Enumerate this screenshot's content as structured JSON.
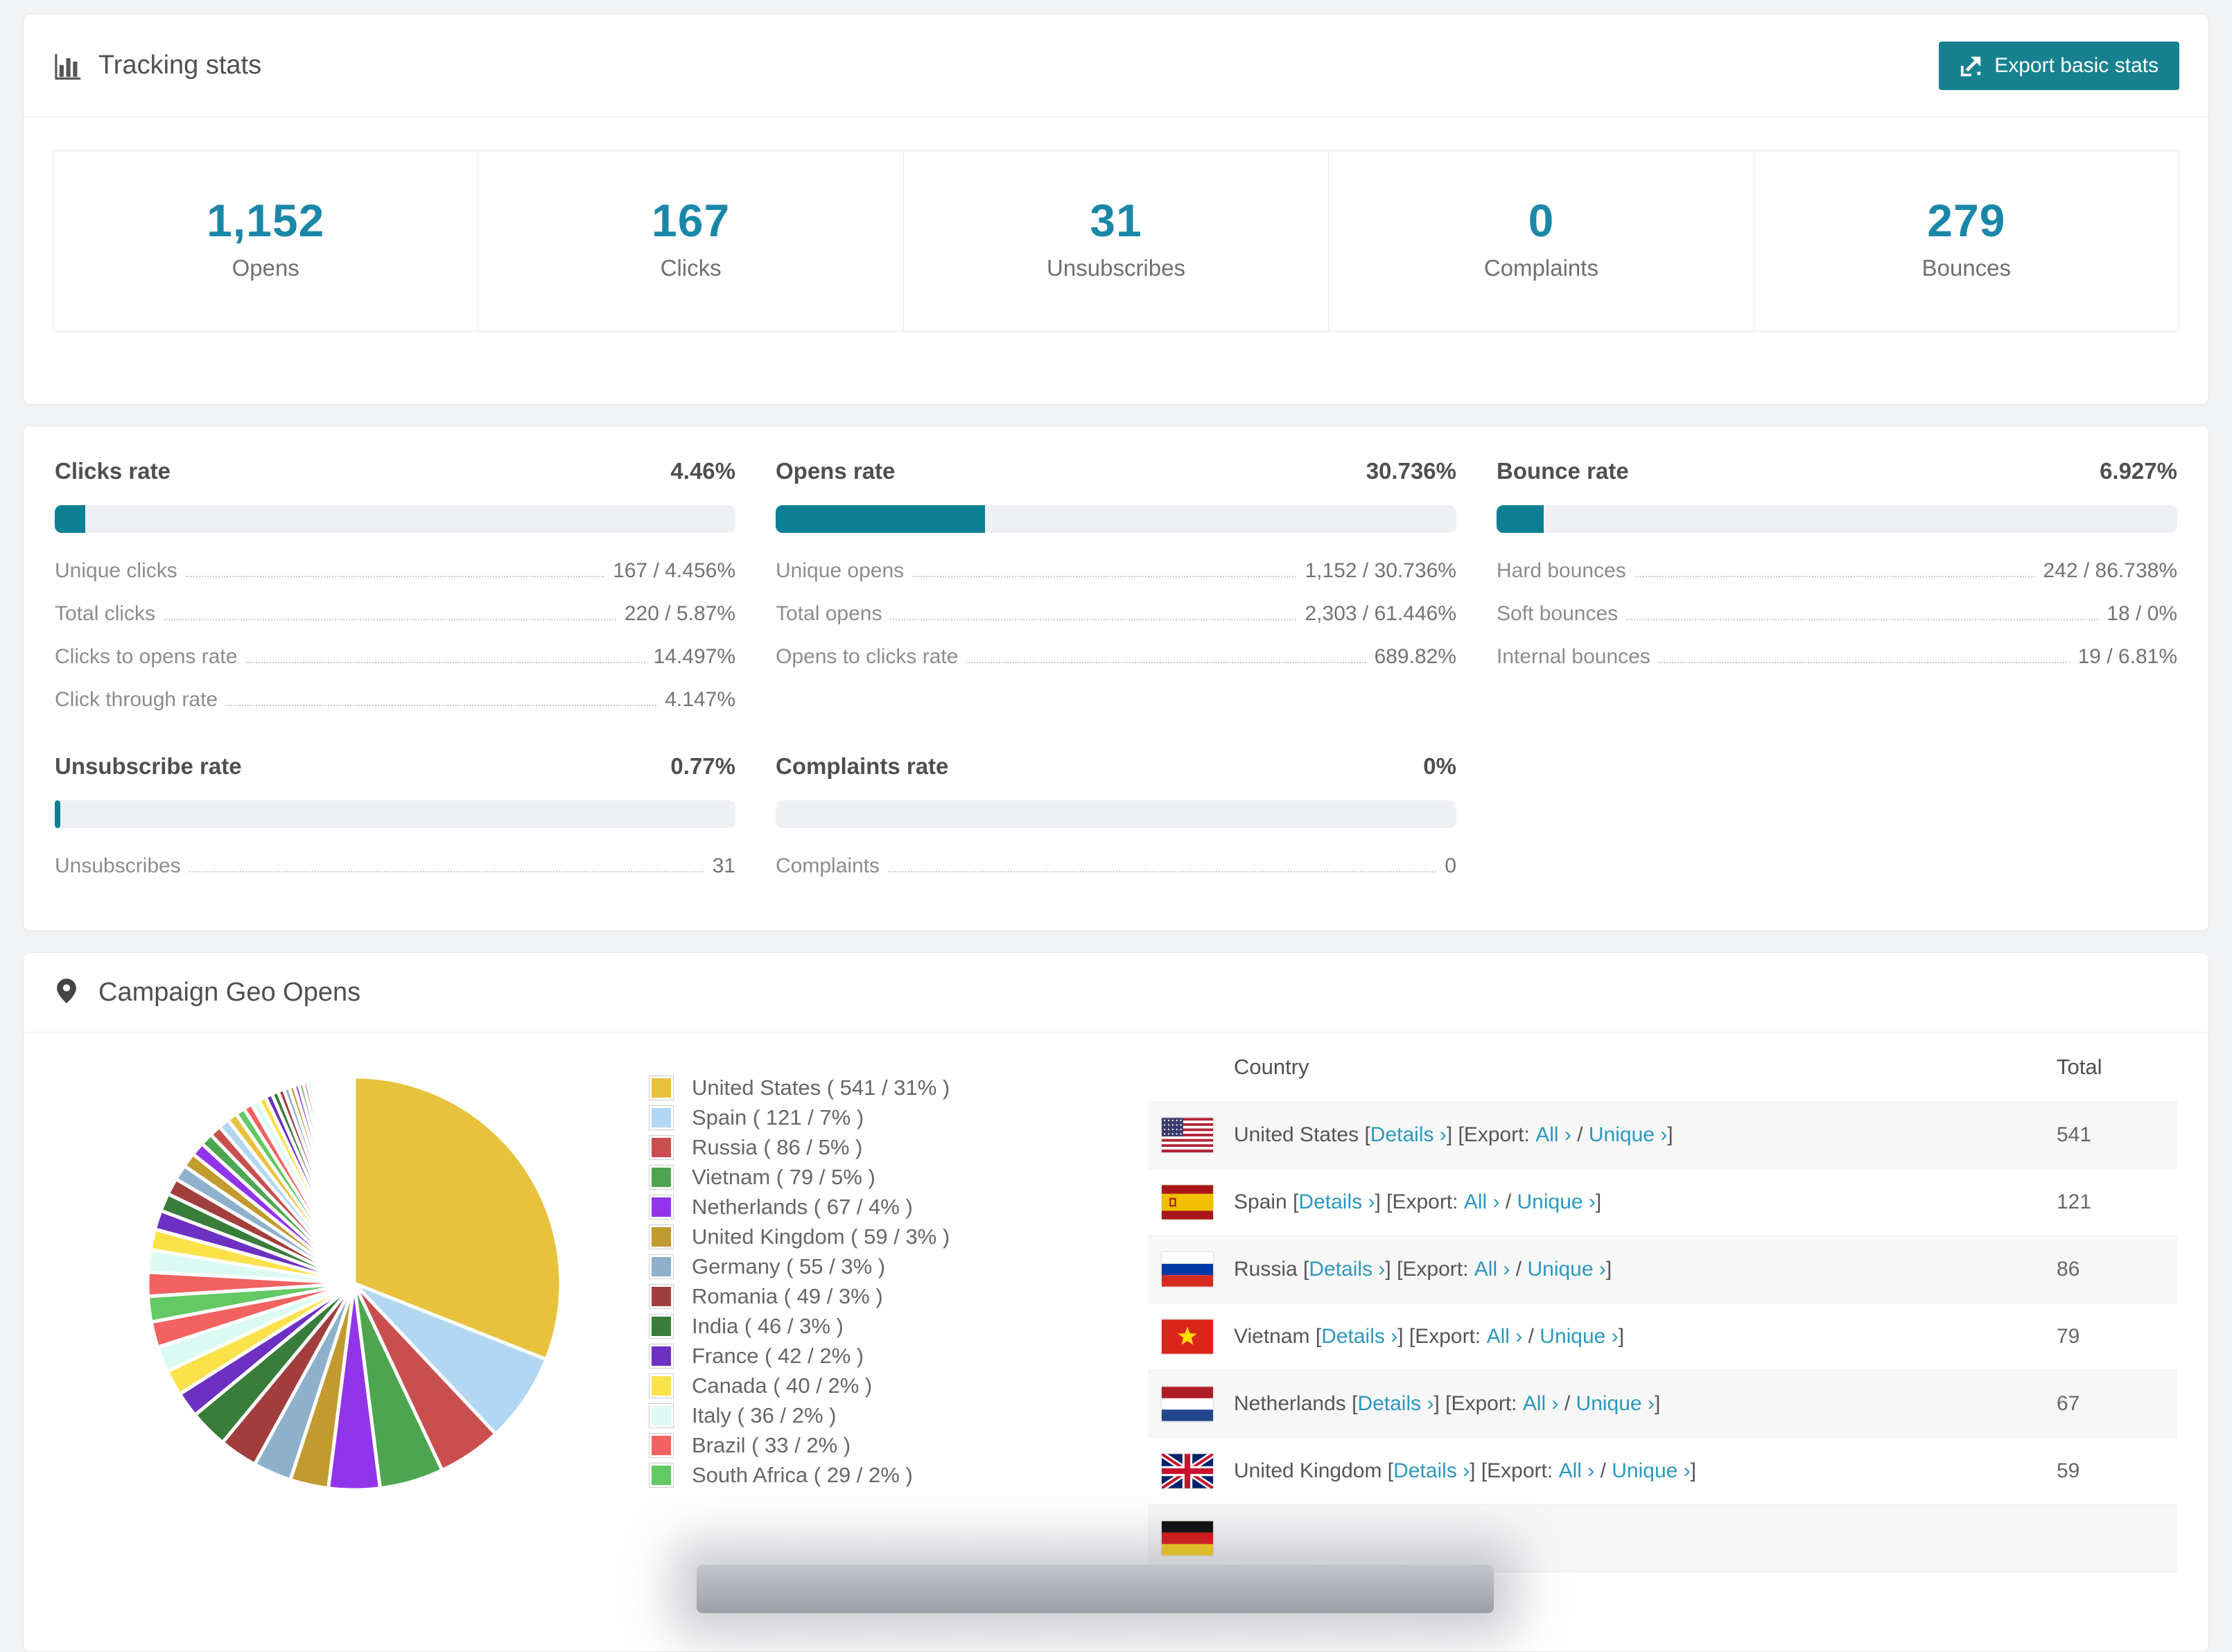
{
  "colors": {
    "accent_teal": "#17818f",
    "stat_number": "#1a87a8",
    "bar_fill": "#0c7f93",
    "bar_bg": "#eef0f3",
    "link": "#2b98bd",
    "row_stripe": "#f7f7f8"
  },
  "tracking": {
    "title": "Tracking stats",
    "icon": "bar-chart-icon",
    "export_label": "Export basic stats",
    "stats": [
      {
        "value": "1,152",
        "label": "Opens"
      },
      {
        "value": "167",
        "label": "Clicks"
      },
      {
        "value": "31",
        "label": "Unsubscribes"
      },
      {
        "value": "0",
        "label": "Complaints"
      },
      {
        "value": "279",
        "label": "Bounces"
      }
    ]
  },
  "rates": [
    {
      "title": "Clicks rate",
      "value_label": "4.46%",
      "percent": 4.46,
      "rows": [
        {
          "label": "Unique clicks",
          "value": "167 / 4.456%"
        },
        {
          "label": "Total clicks",
          "value": "220 / 5.87%"
        },
        {
          "label": "Clicks to opens rate",
          "value": "14.497%"
        },
        {
          "label": "Click through rate",
          "value": "4.147%"
        }
      ]
    },
    {
      "title": "Opens rate",
      "value_label": "30.736%",
      "percent": 30.736,
      "rows": [
        {
          "label": "Unique opens",
          "value": "1,152 / 30.736%"
        },
        {
          "label": "Total opens",
          "value": "2,303 / 61.446%"
        },
        {
          "label": "Opens to clicks rate",
          "value": "689.82%"
        }
      ]
    },
    {
      "title": "Bounce rate",
      "value_label": "6.927%",
      "percent": 6.927,
      "rows": [
        {
          "label": "Hard bounces",
          "value": "242 / 86.738%"
        },
        {
          "label": "Soft bounces",
          "value": "18 / 0%"
        },
        {
          "label": "Internal bounces",
          "value": "19 / 6.81%"
        }
      ]
    },
    {
      "title": "Unsubscribe rate",
      "value_label": "0.77%",
      "percent": 0.77,
      "rows": [
        {
          "label": "Unsubscribes",
          "value": "31"
        }
      ]
    },
    {
      "title": "Complaints rate",
      "value_label": "0%",
      "percent": 0,
      "rows": [
        {
          "label": "Complaints",
          "value": "0"
        }
      ]
    }
  ],
  "geo": {
    "title": "Campaign Geo Opens",
    "icon": "map-marker-icon",
    "table": {
      "country_header": "Country",
      "total_header": "Total",
      "links": {
        "details": "Details",
        "export_prefix": "Export:",
        "all": "All",
        "unique": "Unique",
        "chevron": "›"
      },
      "rows": [
        {
          "country": "United States",
          "flag": "us",
          "total": "541"
        },
        {
          "country": "Spain",
          "flag": "es",
          "total": "121"
        },
        {
          "country": "Russia",
          "flag": "ru",
          "total": "86"
        },
        {
          "country": "Vietnam",
          "flag": "vn",
          "total": "79"
        },
        {
          "country": "Netherlands",
          "flag": "nl",
          "total": "67"
        },
        {
          "country": "United Kingdom",
          "flag": "gb",
          "total": "59"
        }
      ],
      "partial_row": {
        "flag": "de"
      }
    }
  },
  "chart_data": {
    "type": "pie",
    "title": "Campaign Geo Opens",
    "unit": "opens",
    "legend_position": "right",
    "start_angle_deg": -90,
    "direction": "clockwise",
    "items": [
      {
        "name": "United States",
        "value": 541,
        "pct": 31,
        "color": "#e8c23d"
      },
      {
        "name": "Spain",
        "value": 121,
        "pct": 7,
        "color": "#b3d7f2"
      },
      {
        "name": "Russia",
        "value": 86,
        "pct": 5,
        "color": "#c94f4f"
      },
      {
        "name": "Vietnam",
        "value": 79,
        "pct": 5,
        "color": "#4da64f"
      },
      {
        "name": "Netherlands",
        "value": 67,
        "pct": 4,
        "color": "#9135ea"
      },
      {
        "name": "United Kingdom",
        "value": 59,
        "pct": 3,
        "color": "#c19a30"
      },
      {
        "name": "Germany",
        "value": 55,
        "pct": 3,
        "color": "#8fb0ca"
      },
      {
        "name": "Romania",
        "value": 49,
        "pct": 3,
        "color": "#a23e3e"
      },
      {
        "name": "India",
        "value": 46,
        "pct": 3,
        "color": "#397d3b"
      },
      {
        "name": "France",
        "value": 42,
        "pct": 2,
        "color": "#6c30c2"
      },
      {
        "name": "Canada",
        "value": 40,
        "pct": 2,
        "color": "#fbe24b"
      },
      {
        "name": "Italy",
        "value": 36,
        "pct": 2,
        "color": "#dbfaf4"
      },
      {
        "name": "Brazil",
        "value": 33,
        "pct": 2,
        "color": "#f16260"
      },
      {
        "name": "South Africa",
        "value": 29,
        "pct": 2,
        "color": "#62c964"
      }
    ],
    "others_note": "remaining ~26% of opens split across many small unlabeled country slices"
  }
}
